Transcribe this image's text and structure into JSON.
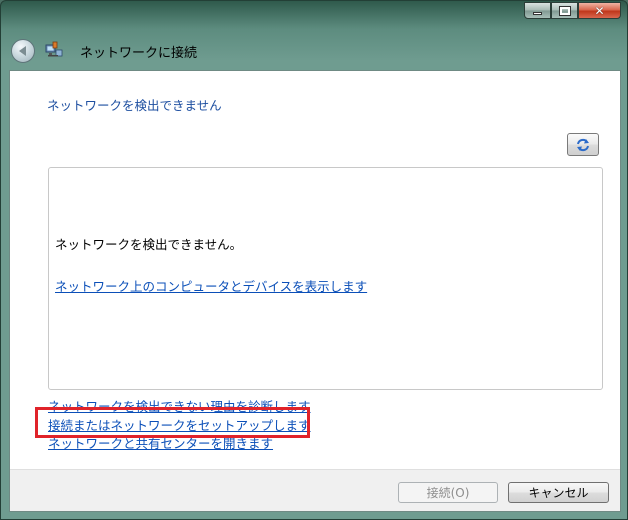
{
  "window": {
    "title": "ネットワークに接続",
    "controls": {
      "minimize": "minimize-icon",
      "maximize": "maximize-icon",
      "close": "close-icon"
    }
  },
  "header": {
    "back_icon": "back-arrow-icon",
    "network_icon": "network-connect-icon"
  },
  "main": {
    "heading": "ネットワークを検出できません",
    "refresh_icon": "refresh-icon",
    "list_message": "ネットワークを検出できません。",
    "list_link": "ネットワーク上のコンピュータとデバイスを表示します"
  },
  "tasks": [
    {
      "label": "ネットワークを検出できない理由を診断します"
    },
    {
      "label": "接続またはネットワークをセットアップします"
    },
    {
      "label": "ネットワークと共有センターを開きます"
    }
  ],
  "footer": {
    "connect_label": "接続(O)",
    "cancel_label": "キャンセル"
  },
  "colors": {
    "link": "#0b4fb8",
    "heading": "#1e4fa0",
    "highlight": "#e0232a"
  }
}
